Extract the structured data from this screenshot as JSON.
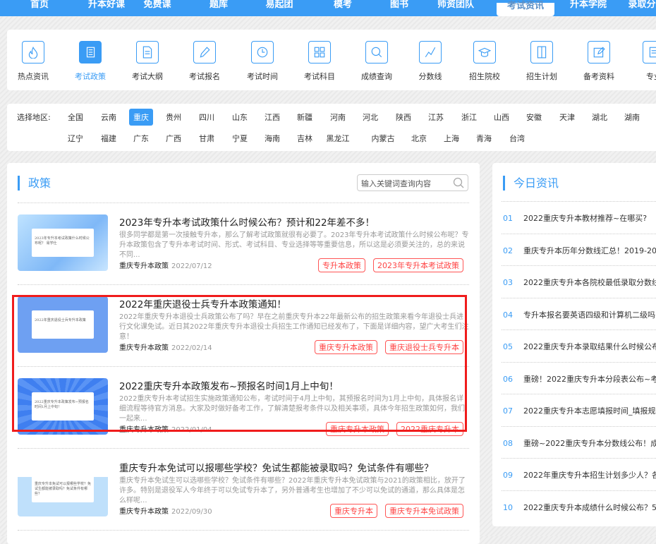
{
  "nav": [
    "首页",
    "升本好课",
    "免费课",
    "题库",
    "易起团",
    "模考",
    "图书",
    "师资团队",
    "考试资讯",
    "升本学院",
    "录取分"
  ],
  "nav_active": 8,
  "categories": [
    {
      "label": "热点资讯",
      "icon": "fire-icon"
    },
    {
      "label": "考试政策",
      "icon": "newspaper-icon",
      "active": true
    },
    {
      "label": "考试大纲",
      "icon": "document-icon"
    },
    {
      "label": "考试报名",
      "icon": "pencil-icon"
    },
    {
      "label": "考试时间",
      "icon": "clock-icon"
    },
    {
      "label": "考试科目",
      "icon": "grid-icon"
    },
    {
      "label": "成绩查询",
      "icon": "search-icon"
    },
    {
      "label": "分数线",
      "icon": "line-chart-icon"
    },
    {
      "label": "招生院校",
      "icon": "graduation-cap-icon"
    },
    {
      "label": "招生计划",
      "icon": "book-icon"
    },
    {
      "label": "备考资料",
      "icon": "edit-icon"
    },
    {
      "label": "专业",
      "icon": "list-icon"
    }
  ],
  "region": {
    "label": "选择地区:",
    "row1": [
      "全国",
      "云南",
      "重庆",
      "贵州",
      "四川",
      "山东",
      "江西",
      "新疆",
      "河南",
      "河北",
      "陕西",
      "江苏",
      "浙江",
      "山西",
      "安徽",
      "天津",
      "湖北",
      "湖南"
    ],
    "row2": [
      "辽宁",
      "福建",
      "广东",
      "广西",
      "甘肃",
      "宁夏",
      "海南",
      "吉林",
      "黑龙江",
      "内蒙古",
      "北京",
      "上海",
      "青海",
      "台湾"
    ],
    "active": "重庆"
  },
  "policy": {
    "title": "政策",
    "search_placeholder": "输入关键词查询内容",
    "articles": [
      {
        "title": "2023年专升本考试政策什么时候公布？预计和22年差不多！",
        "desc": "很多同学都是第一次接触专升本，那么了解考试政策就很有必要了。2023年专升本考试政策什么时候公布呢？专升本政策包含了专升本考试时间、形式、考试科目、专业选择等等重要信息，所以这是必须要关注的，总的来说不同...",
        "category": "重庆专升本政策",
        "date": "2022/07/12",
        "tags": [
          "专升本政策",
          "2023年专升本考试政策"
        ],
        "thumb": "2023年专升本考试政策什么时候公布呢？ 易学仕"
      },
      {
        "title": "2022年重庆退役士兵专升本政策通知！",
        "desc": "2022年重庆专升本退役士兵政策公布了吗？早在之前重庆专升本22年最新公布的招生政策来看今年退役士兵进行文化课免试。近日其2022年重庆专升本退役士兵招生工作通知已经发布了，下面是详细内容，望广大考生们注意！",
        "category": "重庆专升本政策",
        "date": "2022/02/14",
        "tags": [
          "重庆专升本政策",
          "重庆退役士兵专升本"
        ],
        "thumb": "2022年重庆退役士兵专升本政策"
      },
      {
        "title": "2022重庆专升本政策发布~预报名时间1月上中旬！",
        "desc": "2022重庆专升本考试招生实施政策通知公布，考试时间于4月上中旬，其预报名时间为1月上中旬，具体报名详细流程等待官方消息。大家及时做好备考工作，了解清楚报考条件以及相关事项，具体今年招生政策如何，我们一起来...",
        "category": "重庆专升本政策",
        "date": "2022/01/04",
        "tags": [
          "重庆专升本政策",
          "2022重庆专升本"
        ],
        "thumb": "2022重庆专升本政策发布~预报名时间1月上中旬！"
      },
      {
        "title": "重庆专升本免试可以报哪些学校？免试生都能被录取吗？免试条件有哪些？",
        "desc": "重庆专升本免试生可以选哪些学校？免试条件有哪些？2022年重庆专升本免试政策与2021的政策相比，放开了许多。特别是退役军人今年终于可以免试专升本了，另外普通考生也增加了不少可以免试的通道，那么具体是怎么样呢...",
        "category": "重庆专升本政策",
        "date": "2022/09/30",
        "tags": [
          "重庆专升本",
          "重庆专升本免试政策"
        ],
        "thumb": "重庆专升本免试可以报哪些学校？免试生都能被录取吗？免试条件有哪些？"
      }
    ]
  },
  "today": {
    "title": "今日资讯",
    "items": [
      {
        "n": "01",
        "t": "2022重庆专升本教材推荐~在哪买?"
      },
      {
        "n": "02",
        "t": "重庆专升本历年分数线汇总！2019-20"
      },
      {
        "n": "03",
        "t": "2022重庆专升本各院校最低录取分数线"
      },
      {
        "n": "04",
        "t": "专升本报名要英语四级和计算机二级吗"
      },
      {
        "n": "05",
        "t": "2022重庆专升本录取结果什么时候公布"
      },
      {
        "n": "06",
        "t": "重磅！2022重庆专升本分段表公布~考"
      },
      {
        "n": "07",
        "t": "2022重庆专升本志愿填报时间_填报规"
      },
      {
        "n": "08",
        "t": "重磅~2022重庆专升本分数线公布！成"
      },
      {
        "n": "09",
        "t": "2022年重庆专升本招生计划多少人？各"
      },
      {
        "n": "10",
        "t": "2022重庆专升本成绩什么时候公布？5"
      }
    ]
  },
  "colors": {
    "brand": "#3a9cf5",
    "tag": "#ff4444",
    "highlight": "#f01c1c"
  }
}
